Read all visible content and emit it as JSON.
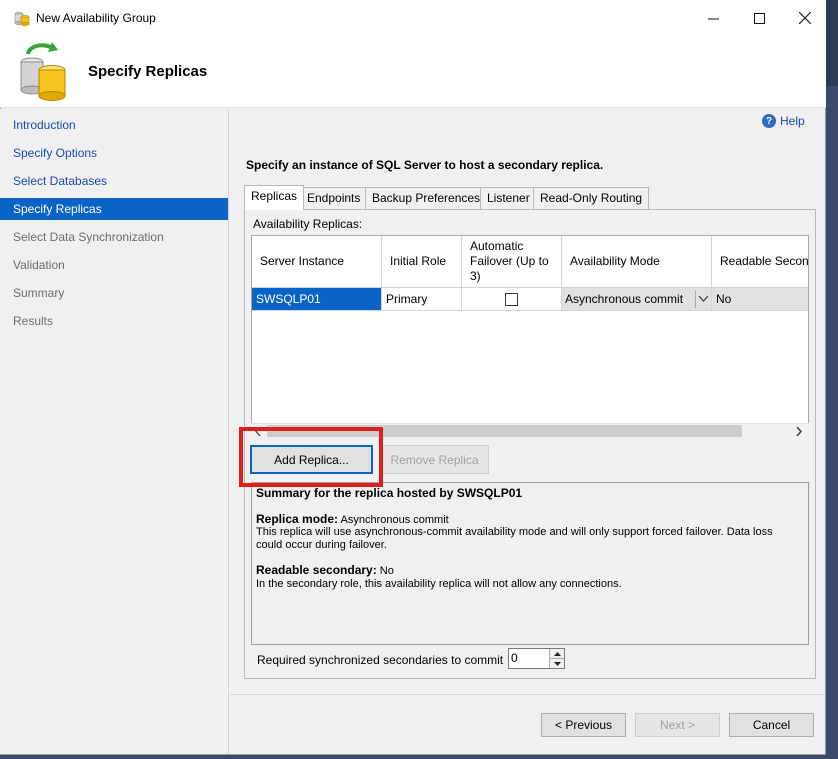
{
  "window": {
    "title": "New Availability Group",
    "page_title": "Specify Replicas"
  },
  "nav": {
    "items": [
      {
        "label": "Introduction",
        "state": "link"
      },
      {
        "label": "Specify Options",
        "state": "link"
      },
      {
        "label": "Select Databases",
        "state": "link"
      },
      {
        "label": "Specify Replicas",
        "state": "active"
      },
      {
        "label": "Select Data Synchronization",
        "state": "disabled"
      },
      {
        "label": "Validation",
        "state": "disabled"
      },
      {
        "label": "Summary",
        "state": "disabled"
      },
      {
        "label": "Results",
        "state": "disabled"
      }
    ]
  },
  "help_label": "Help",
  "instruction": "Specify an instance of SQL Server to host a secondary replica.",
  "tabs": [
    {
      "label": "Replicas",
      "active": true
    },
    {
      "label": "Endpoints",
      "active": false
    },
    {
      "label": "Backup Preferences",
      "active": false
    },
    {
      "label": "Listener",
      "active": false
    },
    {
      "label": "Read-Only Routing",
      "active": false
    }
  ],
  "replicas": {
    "label": "Availability Replicas:",
    "columns": {
      "server_instance": "Server Instance",
      "initial_role": "Initial Role",
      "automatic_failover": "Automatic Failover (Up to 3)",
      "availability_mode": "Availability Mode",
      "readable_secondary": "Readable Seconc"
    },
    "rows": [
      {
        "server_instance": "SWSQLP01",
        "initial_role": "Primary",
        "automatic_failover": false,
        "availability_mode": "Asynchronous commit",
        "readable_secondary": "No"
      }
    ],
    "add_button": "Add Replica...",
    "remove_button": "Remove Replica"
  },
  "summary": {
    "title": "Summary for the replica hosted by SWSQLP01",
    "mode_label": "Replica mode:",
    "mode_value": "Asynchronous commit",
    "mode_desc": "This replica will use asynchronous-commit availability mode and will only support forced failover. Data loss could occur during failover.",
    "readable_label": "Readable secondary:",
    "readable_value": "No",
    "readable_desc": "In the secondary role, this availability replica will not allow any connections."
  },
  "required_sync": {
    "label": "Required synchronized secondaries to commit",
    "value": "0"
  },
  "footer": {
    "previous": "< Previous",
    "next": "Next >",
    "cancel": "Cancel"
  },
  "colors": {
    "accent": "#0a64c8",
    "highlight": "#e01e1e",
    "link": "#1b4aa8"
  }
}
